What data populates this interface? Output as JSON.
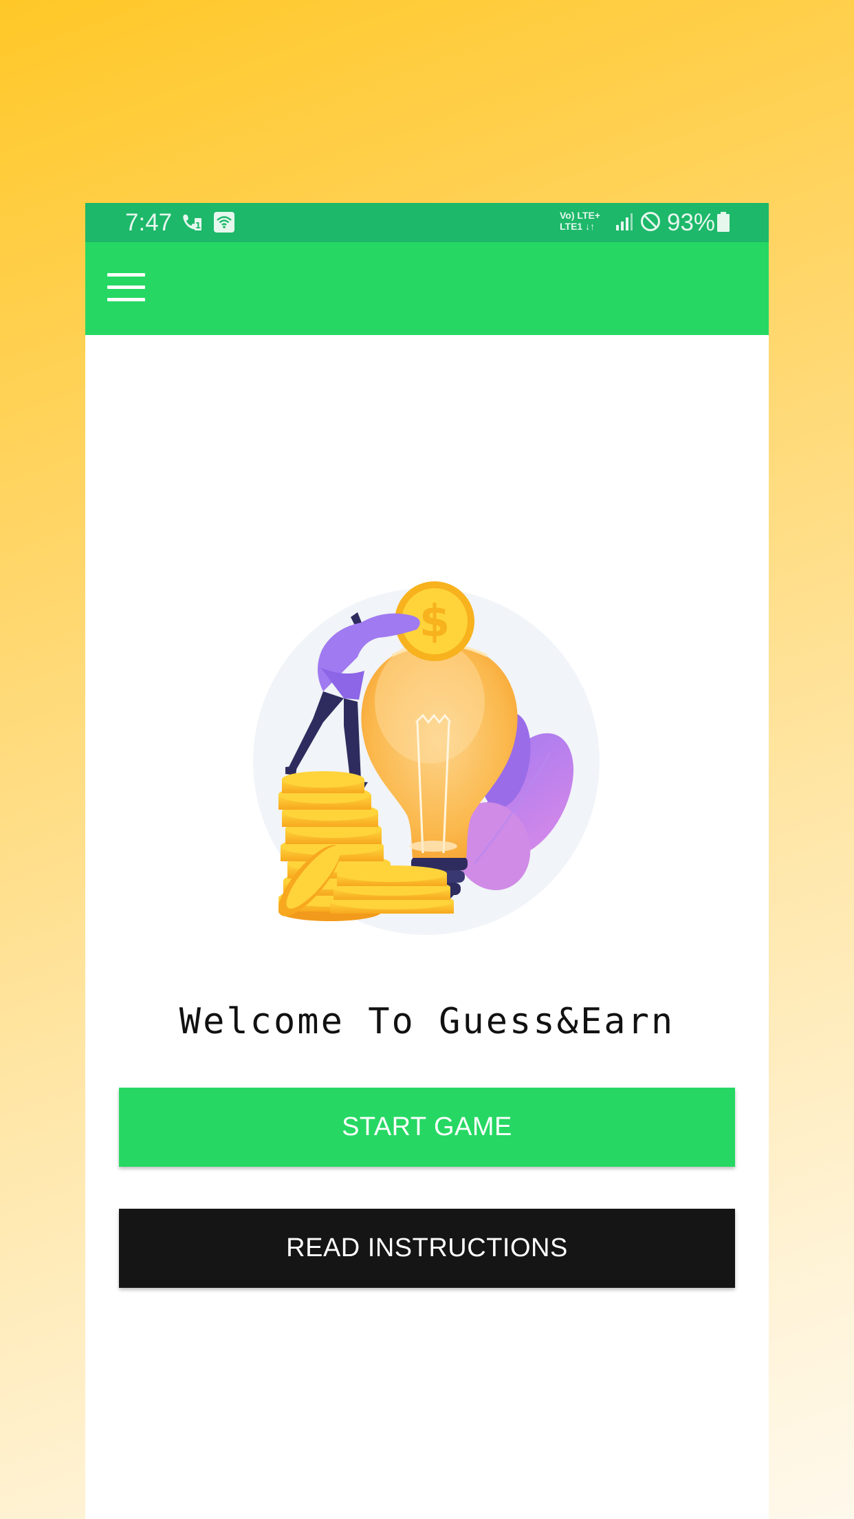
{
  "status_bar": {
    "time": "7:47",
    "network": "Vo) LTE+\nLTE1",
    "battery": "93%",
    "icons": [
      "call-icon",
      "wifi-calling-icon",
      "signal-icon",
      "do-not-disturb-icon",
      "battery-icon"
    ]
  },
  "app_bar": {
    "menu_icon": "hamburger-menu-icon"
  },
  "colors": {
    "status_bar": "#1DB86A",
    "app_bar": "#26D863",
    "start_button": "#26D863",
    "instructions_button": "#151515",
    "background_top": "#FFC828",
    "background_bottom": "#FFF9EC"
  },
  "main": {
    "welcome_text": "Welcome To Guess&Earn",
    "start_button_label": "START GAME",
    "instructions_button_label": "READ INSTRUCTIONS"
  }
}
